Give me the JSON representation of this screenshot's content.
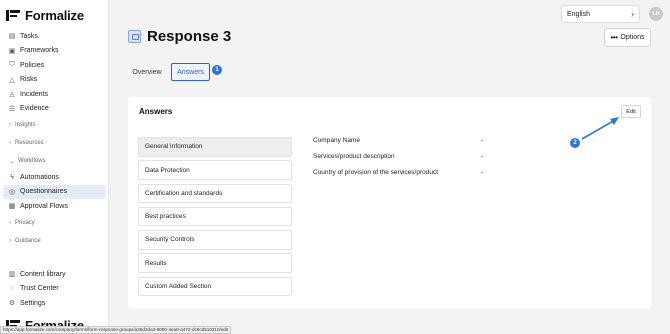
{
  "app": {
    "name": "Formalize"
  },
  "sidebar": {
    "items_top": [
      {
        "label": "Tasks",
        "icon": "tasks-icon"
      },
      {
        "label": "Frameworks",
        "icon": "frameworks-icon"
      },
      {
        "label": "Policies",
        "icon": "shield-icon"
      },
      {
        "label": "Risks",
        "icon": "warning-icon"
      },
      {
        "label": "Incidents",
        "icon": "incident-icon"
      },
      {
        "label": "Evidence",
        "icon": "evidence-icon"
      }
    ],
    "groups": {
      "insights": "Insights",
      "resources": "Resources",
      "workflows": "Workflows",
      "privacy": "Privacy",
      "guidance": "Guidance"
    },
    "workflow_items": [
      {
        "label": "Automations",
        "icon": "lightning-icon"
      },
      {
        "label": "Questionnaires",
        "icon": "questionnaire-icon"
      },
      {
        "label": "Approval Flows",
        "icon": "approval-icon"
      }
    ],
    "items_bottom": [
      {
        "label": "Content library",
        "icon": "library-icon"
      },
      {
        "label": "Trust Center",
        "icon": "check-circle-icon"
      },
      {
        "label": "Settings",
        "icon": "gear-icon"
      }
    ]
  },
  "status_url": "https://app.formalize.com/company/forms/form-response-groups/a36d2da3-8090-4ea0-a472-dc8cd510310/edit",
  "header": {
    "language": "English",
    "avatar_initials": "LH",
    "title": "Response 3",
    "options_label": "Options"
  },
  "tabs": {
    "overview": "Overview",
    "answers": "Answers"
  },
  "badges": {
    "one": "1",
    "two": "2"
  },
  "answers": {
    "title": "Answers",
    "edit_label": "Edit",
    "sections": [
      "General Information",
      "Data Protection",
      "Certification and standards",
      "Best practices",
      "Security Controls",
      "Results",
      "Custom Added Section"
    ],
    "questions": [
      {
        "label": "Company Name",
        "value": "-"
      },
      {
        "label": "Services/product description",
        "value": "-"
      },
      {
        "label": "Country of provision of the services/product",
        "value": "-"
      }
    ]
  },
  "colors": {
    "accent": "#2f5fcf",
    "badge": "#2f74d6",
    "active_nav": "#e5ebf7"
  }
}
